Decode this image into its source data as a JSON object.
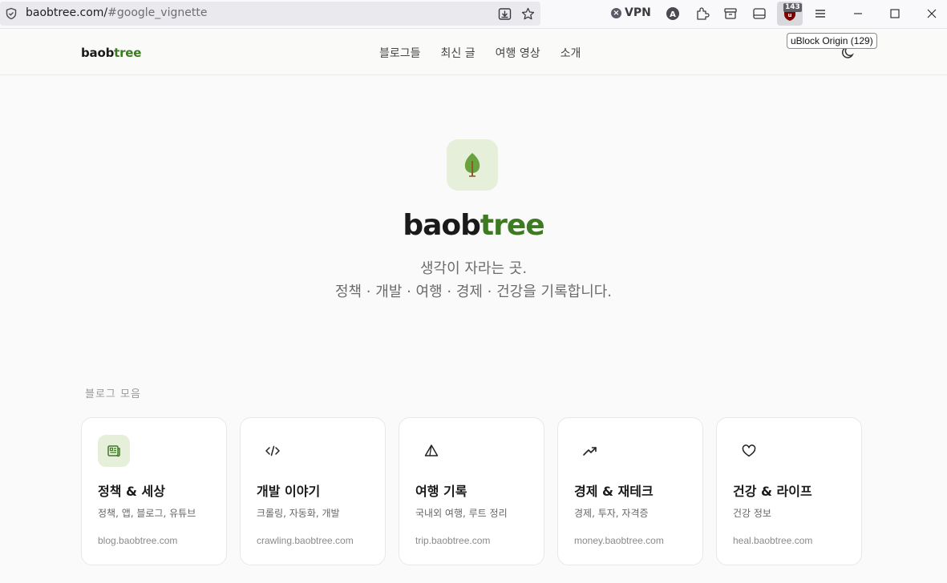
{
  "browser": {
    "url_host": "baobtree.com/",
    "url_rest": "#google_vignette",
    "vpn_label": "VPN",
    "ublock_badge": "143",
    "tooltip": "uBlock Origin (129)",
    "icons": [
      "shield-icon",
      "download-icon",
      "star-icon",
      "account-icon",
      "extensions-icon",
      "container-icon",
      "sidebar-icon",
      "ublock-icon",
      "menu-icon",
      "minimize-icon",
      "maximize-icon",
      "close-icon"
    ]
  },
  "header": {
    "logo_dark": "baob",
    "logo_green": "tree",
    "nav": [
      "블로그들",
      "최신 글",
      "여행 영상",
      "소개"
    ],
    "theme_icon": "moon-icon"
  },
  "hero": {
    "icon": "tree-icon",
    "title_dark": "baob",
    "title_green": "tree",
    "subtitle_line1": "생각이 자라는 곳.",
    "subtitle_line2": "정책 · 개발 · 여행 · 경제 · 건강을 기록합니다."
  },
  "section": {
    "label": "블로그 모음",
    "cards": [
      {
        "icon": "newspaper-icon",
        "title": "정책 & 세상",
        "desc": "정책, 앱, 블로그, 유튜브",
        "url": "blog.baobtree.com"
      },
      {
        "icon": "code-icon",
        "title": "개발 이야기",
        "desc": "크롤링, 자동화, 개발",
        "url": "crawling.baobtree.com"
      },
      {
        "icon": "mountain-icon",
        "title": "여행 기록",
        "desc": "국내외 여행, 루트 정리",
        "url": "trip.baobtree.com"
      },
      {
        "icon": "trending-up-icon",
        "title": "경제 & 재테크",
        "desc": "경제, 투자, 자격증",
        "url": "money.baobtree.com"
      },
      {
        "icon": "heart-icon",
        "title": "건강 & 라이프",
        "desc": "건강 정보",
        "url": "heal.baobtree.com"
      }
    ]
  },
  "colors": {
    "accent_green": "#3d7a22",
    "icon_bg": "#e6efd9",
    "page_bg": "#fafafa"
  }
}
